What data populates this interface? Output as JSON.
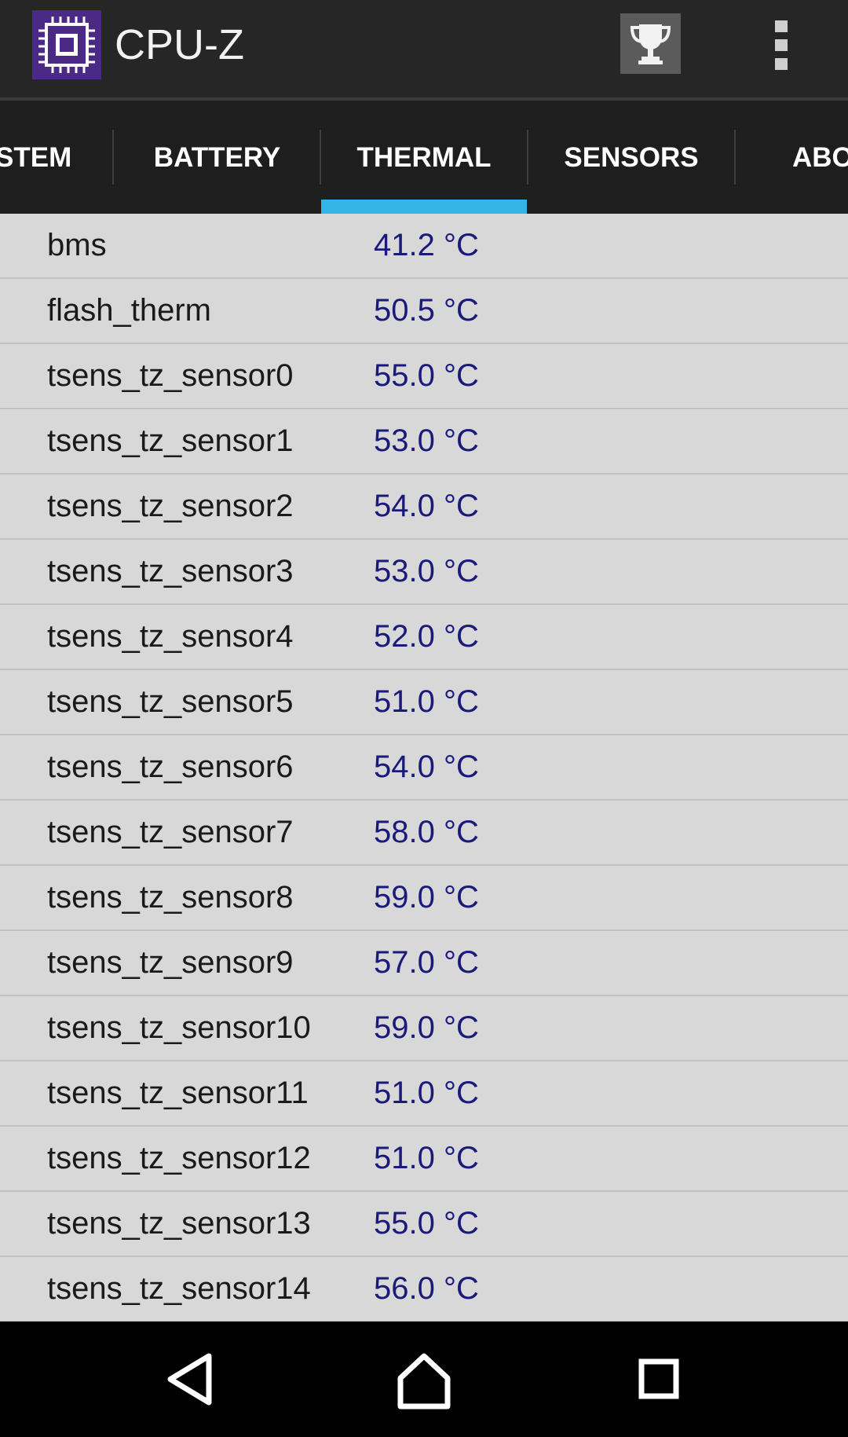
{
  "app": {
    "title": "CPU-Z"
  },
  "action_bar": {
    "icons": [
      "cpu-chip-icon",
      "trophy-icon",
      "overflow-menu-icon"
    ]
  },
  "tabs": [
    {
      "label": "STEM",
      "active": false
    },
    {
      "label": "BATTERY",
      "active": false
    },
    {
      "label": "THERMAL",
      "active": true
    },
    {
      "label": "SENSORS",
      "active": false
    },
    {
      "label": "ABO",
      "active": false
    }
  ],
  "colors": {
    "action_bar": "#262626",
    "tab_bar": "#1e1e1e",
    "tab_indicator": "#33b5e5",
    "list_background": "#d8d8d8",
    "value_text": "#1a1a7a",
    "app_icon": "#4b2a86"
  },
  "thermal": {
    "rows": [
      {
        "name": "bms",
        "value": "41.2 °C"
      },
      {
        "name": "flash_therm",
        "value": "50.5 °C"
      },
      {
        "name": "tsens_tz_sensor0",
        "value": "55.0 °C"
      },
      {
        "name": "tsens_tz_sensor1",
        "value": "53.0 °C"
      },
      {
        "name": "tsens_tz_sensor2",
        "value": "54.0 °C"
      },
      {
        "name": "tsens_tz_sensor3",
        "value": "53.0 °C"
      },
      {
        "name": "tsens_tz_sensor4",
        "value": "52.0 °C"
      },
      {
        "name": "tsens_tz_sensor5",
        "value": "51.0 °C"
      },
      {
        "name": "tsens_tz_sensor6",
        "value": "54.0 °C"
      },
      {
        "name": "tsens_tz_sensor7",
        "value": "58.0 °C"
      },
      {
        "name": "tsens_tz_sensor8",
        "value": "59.0 °C"
      },
      {
        "name": "tsens_tz_sensor9",
        "value": "57.0 °C"
      },
      {
        "name": "tsens_tz_sensor10",
        "value": "59.0 °C"
      },
      {
        "name": "tsens_tz_sensor11",
        "value": "51.0 °C"
      },
      {
        "name": "tsens_tz_sensor12",
        "value": "51.0 °C"
      },
      {
        "name": "tsens_tz_sensor13",
        "value": "55.0 °C"
      },
      {
        "name": "tsens_tz_sensor14",
        "value": "56.0 °C"
      }
    ]
  },
  "nav_bar": {
    "icons": [
      "back-icon",
      "home-icon",
      "recents-icon"
    ]
  }
}
